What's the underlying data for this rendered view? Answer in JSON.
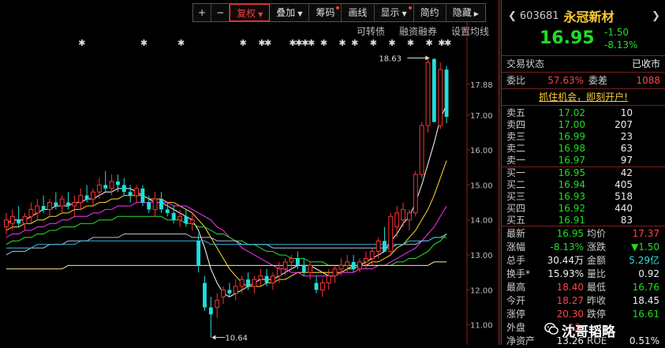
{
  "toolbar": {
    "plus": "+",
    "minus": "−",
    "fuquan": "复权",
    "diejia": "叠加",
    "chouma": "筹码",
    "huaxian": "画线",
    "xianshi": "显示",
    "jianyue": "简约",
    "yincang": "隐藏"
  },
  "sublinks": {
    "convertible": "可转债",
    "margin": "融资融券",
    "ma_settings": "设置均线"
  },
  "chart_data": {
    "type": "candlestick",
    "yticks": [
      "17.88",
      "17.00",
      "16.00",
      "15.00",
      "14.00",
      "13.00",
      "12.00",
      "11.00"
    ],
    "ylim": [
      10.7,
      18.8
    ],
    "high_annotation": "18.63",
    "low_annotation": "10.64",
    "candles": [
      {
        "o": 13.8,
        "h": 14.2,
        "l": 13.6,
        "c": 14.0
      },
      {
        "o": 13.9,
        "h": 14.3,
        "l": 13.7,
        "c": 14.1
      },
      {
        "o": 14.0,
        "h": 14.4,
        "l": 13.8,
        "c": 13.9
      },
      {
        "o": 13.9,
        "h": 14.2,
        "l": 13.7,
        "c": 14.1
      },
      {
        "o": 14.1,
        "h": 14.5,
        "l": 13.9,
        "c": 14.3
      },
      {
        "o": 14.2,
        "h": 14.6,
        "l": 14.0,
        "c": 14.4
      },
      {
        "o": 14.4,
        "h": 14.7,
        "l": 14.2,
        "c": 14.3
      },
      {
        "o": 14.3,
        "h": 14.6,
        "l": 14.1,
        "c": 14.5
      },
      {
        "o": 14.5,
        "h": 14.8,
        "l": 14.3,
        "c": 14.4
      },
      {
        "o": 14.4,
        "h": 14.7,
        "l": 14.2,
        "c": 14.6
      },
      {
        "o": 14.5,
        "h": 14.8,
        "l": 14.3,
        "c": 14.4
      },
      {
        "o": 14.4,
        "h": 14.7,
        "l": 14.1,
        "c": 14.5
      },
      {
        "o": 14.5,
        "h": 14.9,
        "l": 14.3,
        "c": 14.7
      },
      {
        "o": 14.7,
        "h": 15.0,
        "l": 14.5,
        "c": 14.6
      },
      {
        "o": 14.6,
        "h": 14.9,
        "l": 14.4,
        "c": 14.8
      },
      {
        "o": 14.8,
        "h": 15.2,
        "l": 14.6,
        "c": 15.0
      },
      {
        "o": 15.0,
        "h": 15.4,
        "l": 14.8,
        "c": 14.9
      },
      {
        "o": 14.9,
        "h": 15.3,
        "l": 14.7,
        "c": 15.1
      },
      {
        "o": 15.1,
        "h": 15.3,
        "l": 14.8,
        "c": 15.0
      },
      {
        "o": 15.0,
        "h": 15.2,
        "l": 14.7,
        "c": 14.8
      },
      {
        "o": 14.8,
        "h": 15.0,
        "l": 14.5,
        "c": 14.7
      },
      {
        "o": 14.7,
        "h": 15.0,
        "l": 14.5,
        "c": 14.9
      },
      {
        "o": 14.9,
        "h": 15.0,
        "l": 14.4,
        "c": 14.5
      },
      {
        "o": 14.5,
        "h": 14.7,
        "l": 14.2,
        "c": 14.3
      },
      {
        "o": 14.3,
        "h": 14.8,
        "l": 14.1,
        "c": 14.6
      },
      {
        "o": 14.6,
        "h": 14.8,
        "l": 14.2,
        "c": 14.3
      },
      {
        "o": 14.3,
        "h": 14.5,
        "l": 14.1,
        "c": 14.2
      },
      {
        "o": 14.2,
        "h": 14.4,
        "l": 13.9,
        "c": 14.0
      },
      {
        "o": 14.0,
        "h": 14.3,
        "l": 13.8,
        "c": 14.1
      },
      {
        "o": 14.1,
        "h": 14.3,
        "l": 13.8,
        "c": 13.9
      },
      {
        "o": 13.9,
        "h": 14.2,
        "l": 13.7,
        "c": 14.0
      },
      {
        "o": 13.4,
        "h": 13.6,
        "l": 12.5,
        "c": 12.7
      },
      {
        "o": 12.2,
        "h": 12.4,
        "l": 11.4,
        "c": 11.5
      },
      {
        "o": 11.5,
        "h": 11.8,
        "l": 10.64,
        "c": 11.3
      },
      {
        "o": 11.5,
        "h": 11.9,
        "l": 11.2,
        "c": 11.7
      },
      {
        "o": 11.8,
        "h": 12.1,
        "l": 11.6,
        "c": 12.0
      },
      {
        "o": 12.0,
        "h": 12.2,
        "l": 11.8,
        "c": 11.9
      },
      {
        "o": 11.9,
        "h": 12.3,
        "l": 11.7,
        "c": 12.1
      },
      {
        "o": 12.1,
        "h": 12.4,
        "l": 11.9,
        "c": 12.3
      },
      {
        "o": 12.3,
        "h": 12.5,
        "l": 12.0,
        "c": 12.1
      },
      {
        "o": 12.1,
        "h": 12.4,
        "l": 11.9,
        "c": 12.3
      },
      {
        "o": 12.3,
        "h": 12.6,
        "l": 12.1,
        "c": 12.4
      },
      {
        "o": 12.4,
        "h": 12.6,
        "l": 12.1,
        "c": 12.2
      },
      {
        "o": 12.2,
        "h": 12.5,
        "l": 12.0,
        "c": 12.4
      },
      {
        "o": 12.4,
        "h": 12.8,
        "l": 12.2,
        "c": 12.6
      },
      {
        "o": 12.6,
        "h": 12.9,
        "l": 12.4,
        "c": 12.8
      },
      {
        "o": 12.8,
        "h": 13.0,
        "l": 12.6,
        "c": 12.9
      },
      {
        "o": 12.9,
        "h": 13.1,
        "l": 12.6,
        "c": 12.7
      },
      {
        "o": 12.7,
        "h": 12.9,
        "l": 12.4,
        "c": 12.5
      },
      {
        "o": 12.5,
        "h": 12.8,
        "l": 12.3,
        "c": 12.7
      },
      {
        "o": 12.2,
        "h": 12.4,
        "l": 11.9,
        "c": 12.0
      },
      {
        "o": 12.0,
        "h": 12.3,
        "l": 11.8,
        "c": 12.2
      },
      {
        "o": 12.2,
        "h": 12.6,
        "l": 12.0,
        "c": 12.4
      },
      {
        "o": 12.4,
        "h": 12.7,
        "l": 12.2,
        "c": 12.6
      },
      {
        "o": 12.6,
        "h": 12.9,
        "l": 12.4,
        "c": 12.7
      },
      {
        "o": 12.7,
        "h": 13.0,
        "l": 12.5,
        "c": 12.8
      },
      {
        "o": 12.8,
        "h": 13.0,
        "l": 12.5,
        "c": 12.6
      },
      {
        "o": 12.6,
        "h": 12.9,
        "l": 12.5,
        "c": 12.8
      },
      {
        "o": 12.8,
        "h": 13.1,
        "l": 12.6,
        "c": 12.9
      },
      {
        "o": 12.9,
        "h": 13.2,
        "l": 12.7,
        "c": 13.1
      },
      {
        "o": 13.1,
        "h": 13.5,
        "l": 12.9,
        "c": 13.4
      },
      {
        "o": 13.4,
        "h": 13.8,
        "l": 13.2,
        "c": 13.1
      },
      {
        "o": 13.1,
        "h": 14.2,
        "l": 13.0,
        "c": 14.1
      },
      {
        "o": 13.8,
        "h": 14.4,
        "l": 13.5,
        "c": 14.2
      },
      {
        "o": 14.0,
        "h": 14.5,
        "l": 13.8,
        "c": 14.3
      },
      {
        "o": 14.0,
        "h": 14.3,
        "l": 13.7,
        "c": 14.2
      },
      {
        "o": 14.2,
        "h": 15.4,
        "l": 14.1,
        "c": 15.3
      },
      {
        "o": 15.3,
        "h": 16.8,
        "l": 15.2,
        "c": 16.7
      },
      {
        "o": 16.7,
        "h": 18.6,
        "l": 16.5,
        "c": 18.5
      },
      {
        "o": 18.6,
        "h": 18.63,
        "l": 16.8,
        "c": 16.8
      },
      {
        "o": 16.7,
        "h": 18.5,
        "l": 16.6,
        "c": 18.3
      },
      {
        "o": 18.3,
        "h": 18.4,
        "l": 16.76,
        "c": 16.95
      }
    ],
    "ma_lines": [
      {
        "color": "#ffffff",
        "values": [
          13.9,
          14.0,
          14.0,
          14.0,
          14.1,
          14.2,
          14.3,
          14.3,
          14.4,
          14.4,
          14.4,
          14.5,
          14.5,
          14.6,
          14.6,
          14.7,
          14.8,
          14.8,
          14.9,
          14.9,
          14.9,
          14.8,
          14.7,
          14.6,
          14.5,
          14.5,
          14.4,
          14.3,
          14.2,
          14.1,
          14.0,
          13.7,
          13.2,
          12.6,
          12.2,
          11.9,
          11.8,
          11.9,
          12.0,
          12.1,
          12.2,
          12.3,
          12.3,
          12.3,
          12.4,
          12.5,
          12.6,
          12.7,
          12.7,
          12.7,
          12.6,
          12.5,
          12.4,
          12.4,
          12.5,
          12.6,
          12.7,
          12.7,
          12.8,
          12.9,
          13.0,
          13.1,
          13.4,
          13.6,
          13.9,
          14.1,
          14.5,
          15.0,
          15.6,
          16.2,
          16.9,
          17.3
        ]
      },
      {
        "color": "#ffdd33",
        "values": [
          13.7,
          13.8,
          13.8,
          13.9,
          13.9,
          14.0,
          14.0,
          14.1,
          14.1,
          14.2,
          14.2,
          14.3,
          14.3,
          14.4,
          14.4,
          14.5,
          14.5,
          14.6,
          14.6,
          14.7,
          14.7,
          14.7,
          14.7,
          14.6,
          14.6,
          14.6,
          14.5,
          14.5,
          14.4,
          14.3,
          14.2,
          14.0,
          13.8,
          13.5,
          13.2,
          12.9,
          12.6,
          12.4,
          12.2,
          12.1,
          12.1,
          12.1,
          12.2,
          12.2,
          12.3,
          12.3,
          12.4,
          12.5,
          12.5,
          12.5,
          12.5,
          12.5,
          12.5,
          12.5,
          12.5,
          12.6,
          12.6,
          12.7,
          12.7,
          12.8,
          12.8,
          12.9,
          13.0,
          13.2,
          13.3,
          13.5,
          13.7,
          14.0,
          14.3,
          14.7,
          15.2,
          15.7
        ]
      },
      {
        "color": "#ff33ff",
        "values": [
          13.5,
          13.6,
          13.6,
          13.7,
          13.7,
          13.8,
          13.8,
          13.9,
          13.9,
          14.0,
          14.0,
          14.1,
          14.1,
          14.1,
          14.2,
          14.2,
          14.3,
          14.3,
          14.4,
          14.4,
          14.4,
          14.5,
          14.5,
          14.5,
          14.5,
          14.5,
          14.5,
          14.4,
          14.4,
          14.4,
          14.3,
          14.2,
          14.1,
          14.0,
          13.8,
          13.7,
          13.5,
          13.4,
          13.2,
          13.1,
          13.0,
          12.9,
          12.8,
          12.7,
          12.6,
          12.6,
          12.5,
          12.5,
          12.4,
          12.4,
          12.4,
          12.4,
          12.4,
          12.4,
          12.5,
          12.5,
          12.5,
          12.6,
          12.6,
          12.6,
          12.7,
          12.7,
          12.8,
          12.9,
          13.0,
          13.1,
          13.2,
          13.4,
          13.6,
          13.8,
          14.1,
          14.4
        ]
      },
      {
        "color": "#33dd33",
        "values": [
          13.3,
          13.4,
          13.4,
          13.5,
          13.5,
          13.6,
          13.6,
          13.7,
          13.7,
          13.8,
          13.8,
          13.8,
          13.9,
          13.9,
          13.9,
          14.0,
          14.0,
          14.0,
          14.1,
          14.1,
          14.1,
          14.1,
          14.1,
          14.1,
          14.1,
          14.1,
          14.0,
          14.0,
          14.0,
          13.9,
          13.9,
          13.8,
          13.8,
          13.7,
          13.6,
          13.6,
          13.5,
          13.4,
          13.4,
          13.3,
          13.3,
          13.2,
          13.1,
          13.1,
          13.0,
          13.0,
          12.9,
          12.9,
          12.9,
          12.8,
          12.8,
          12.8,
          12.7,
          12.7,
          12.7,
          12.7,
          12.7,
          12.7,
          12.7,
          12.7,
          12.7,
          12.7,
          12.7,
          12.8,
          12.8,
          12.9,
          12.9,
          13.0,
          13.1,
          13.3,
          13.4,
          13.6
        ]
      },
      {
        "color": "#bbbbdd",
        "values": [
          13.0,
          13.1,
          13.1,
          13.1,
          13.2,
          13.2,
          13.2,
          13.3,
          13.3,
          13.3,
          13.4,
          13.4,
          13.4,
          13.4,
          13.5,
          13.5,
          13.5,
          13.5,
          13.5,
          13.6,
          13.6,
          13.6,
          13.6,
          13.6,
          13.6,
          13.6,
          13.6,
          13.6,
          13.6,
          13.6,
          13.5,
          13.5,
          13.5,
          13.5,
          13.4,
          13.4,
          13.4,
          13.4,
          13.3,
          13.3,
          13.3,
          13.3,
          13.3,
          13.2,
          13.2,
          13.2,
          13.2,
          13.2,
          13.2,
          13.2,
          13.2,
          13.2,
          13.2,
          13.2,
          13.2,
          13.2,
          13.2,
          13.2,
          13.2,
          13.2,
          13.2,
          13.2,
          13.2,
          13.3,
          13.3,
          13.3,
          13.3,
          13.4,
          13.4,
          13.5,
          13.5,
          13.6
        ]
      },
      {
        "color": "#33bbdd",
        "values": [
          13.2,
          13.2,
          13.2,
          13.2,
          13.2,
          13.3,
          13.3,
          13.3,
          13.3,
          13.3,
          13.3,
          13.3,
          13.4,
          13.4,
          13.4,
          13.4,
          13.4,
          13.4,
          13.4,
          13.4,
          13.4,
          13.4,
          13.4,
          13.4,
          13.4,
          13.4,
          13.4,
          13.4,
          13.4,
          13.4,
          13.4,
          13.4,
          13.4,
          13.3,
          13.3,
          13.3,
          13.3,
          13.3,
          13.3,
          13.3,
          13.3,
          13.3,
          13.3,
          13.3,
          13.3,
          13.3,
          13.3,
          13.3,
          13.3,
          13.3,
          13.3,
          13.3,
          13.3,
          13.3,
          13.3,
          13.3,
          13.3,
          13.3,
          13.3,
          13.3,
          13.3,
          13.3,
          13.3,
          13.3,
          13.3,
          13.4,
          13.4,
          13.4,
          13.4,
          13.5,
          13.5,
          13.5
        ]
      },
      {
        "color": "#ffee99",
        "values": [
          12.6,
          12.6,
          12.6,
          12.6,
          12.6,
          12.6,
          12.6,
          12.6,
          12.6,
          12.6,
          12.7,
          12.7,
          12.7,
          12.7,
          12.7,
          12.7,
          12.7,
          12.7,
          12.7,
          12.7,
          12.7,
          12.7,
          12.7,
          12.7,
          12.7,
          12.7,
          12.7,
          12.7,
          12.7,
          12.7,
          12.7,
          12.7,
          12.7,
          12.7,
          12.7,
          12.7,
          12.7,
          12.7,
          12.7,
          12.7,
          12.7,
          12.7,
          12.7,
          12.7,
          12.7,
          12.7,
          12.7,
          12.7,
          12.7,
          12.7,
          12.7,
          12.7,
          12.7,
          12.7,
          12.7,
          12.7,
          12.7,
          12.7,
          12.7,
          12.7,
          12.7,
          12.7,
          12.7,
          12.7,
          12.7,
          12.7,
          12.7,
          12.7,
          12.7,
          12.8,
          12.8,
          12.8
        ]
      }
    ],
    "star_marks": [
      12,
      22,
      28,
      38,
      41,
      42,
      46,
      47,
      48,
      49,
      51,
      54,
      56,
      59,
      62,
      65,
      68,
      70,
      71
    ]
  },
  "panel": {
    "code": "603681",
    "name": "永冠新材",
    "price": "16.95",
    "change": "-1.50",
    "change_pct": "-8.13%",
    "trade_status_label": "交易状态",
    "trade_status_value": "已收市",
    "weibi_label": "委比",
    "weibi_value": "57.63%",
    "weicha_label": "委差",
    "weicha_value": "1088",
    "promo": "抓住机会，即刻开户!",
    "sell": [
      {
        "label": "卖五",
        "price": "17.02",
        "vol": "10"
      },
      {
        "label": "卖四",
        "price": "17.00",
        "vol": "207"
      },
      {
        "label": "卖三",
        "price": "16.99",
        "vol": "23"
      },
      {
        "label": "卖二",
        "price": "16.98",
        "vol": "63"
      },
      {
        "label": "卖一",
        "price": "16.97",
        "vol": "97"
      }
    ],
    "buy": [
      {
        "label": "买一",
        "price": "16.95",
        "vol": "42"
      },
      {
        "label": "买二",
        "price": "16.94",
        "vol": "405"
      },
      {
        "label": "买三",
        "price": "16.93",
        "vol": "518"
      },
      {
        "label": "买四",
        "price": "16.92",
        "vol": "440"
      },
      {
        "label": "买五",
        "price": "16.91",
        "vol": "83"
      }
    ],
    "stats": [
      {
        "l1": "最新",
        "v1": "16.95",
        "c1": "green",
        "l2": "均价",
        "v2": "17.37",
        "c2": "red"
      },
      {
        "l1": "涨幅",
        "v1": "-8.13%",
        "c1": "green",
        "l2": "涨跌",
        "v2": "▼1.50",
        "c2": "green"
      },
      {
        "l1": "总手",
        "v1": "30.44万",
        "c1": "white",
        "l2": "金额",
        "v2": "5.29亿",
        "c2": "cyan"
      },
      {
        "l1": "换手*",
        "v1": "15.93%",
        "c1": "white",
        "l2": "量比",
        "v2": "0.92",
        "c2": "white"
      },
      {
        "l1": "最高",
        "v1": "18.40",
        "c1": "red",
        "l2": "最低",
        "v2": "16.76",
        "c2": "green"
      },
      {
        "l1": "今开",
        "v1": "18.27",
        "c1": "red",
        "l2": "昨收",
        "v2": "18.45",
        "c2": "white"
      },
      {
        "l1": "涨停",
        "v1": "20.30",
        "c1": "red",
        "l2": "跌停",
        "v2": "16.61",
        "c2": "green"
      },
      {
        "l1": "外盘",
        "v1": "12.",
        "c1": "red",
        "l2": "",
        "v2": "",
        "c2": "white"
      },
      {
        "l1": "净资产",
        "v1": "13.26",
        "c1": "white",
        "l2": "ROE",
        "v2": "0.51%",
        "c2": "white"
      }
    ],
    "watermark": "沈哥韬略"
  },
  "colors": {
    "up": "#ff3333",
    "down": "#22dddd",
    "accent": "#ff3b3b",
    "name": "#ffcc33"
  }
}
